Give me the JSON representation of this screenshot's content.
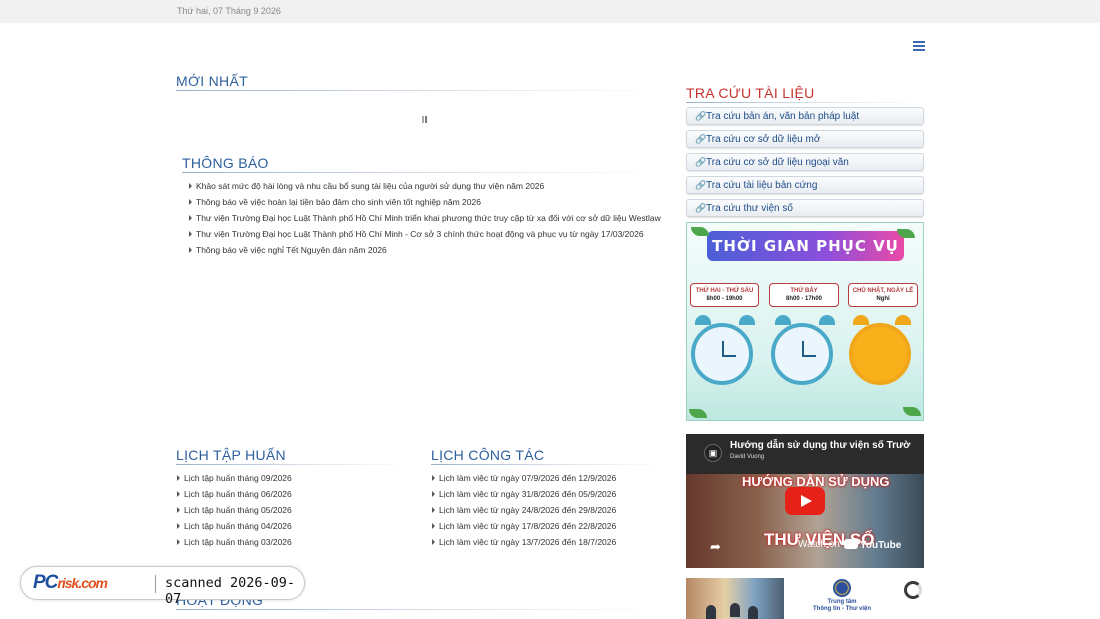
{
  "top_bar": {
    "date": "Thứ hai, 07 Tháng 9 2026"
  },
  "sections": {
    "moi_nhat": "MỚI NHẤT",
    "thong_bao": "THÔNG BÁO",
    "lich_tap_huan": "LỊCH TẬP HUẤN",
    "lich_cong_tac": "LỊCH CÔNG TÁC",
    "hoat_dong": "HOẠT ĐỘNG",
    "tra_cuu": "TRA CỨU TÀI LIỆU"
  },
  "thong_bao_items": [
    "Khảo sát mức độ hài lòng và nhu cầu bổ sung tài liệu của người sử dụng thư viện năm 2026",
    "Thông báo về việc hoàn lại tiền bảo đảm cho sinh viên tốt nghiệp năm 2026",
    "Thư viện Trường Đại học Luật Thành phố Hồ Chí Minh triển khai phương thức truy cập từ xa đối với cơ sở dữ liệu Westlaw",
    "Thư viện Trường Đại học Luật Thành phố Hồ Chí Minh - Cơ sở 3 chính thức hoạt động và phục vụ từ ngày 17/03/2026",
    "Thông báo về việc nghỉ Tết Nguyên đán năm 2026"
  ],
  "lich_tap_huan_items": [
    "Lịch tập huấn tháng 09/2026",
    "Lịch tập huấn tháng 06/2026",
    "Lịch tập huấn tháng 05/2026",
    "Lịch tập huấn tháng 04/2026",
    "Lịch tập huấn tháng 03/2026"
  ],
  "lich_cong_tac_items": [
    "Lịch làm việc từ ngày 07/9/2026 đến 12/9/2026",
    "Lịch làm việc từ ngày 31/8/2026 đến 05/9/2026",
    "Lịch làm việc từ ngày 24/8/2026 đến 29/8/2026",
    "Lịch làm việc từ ngày 17/8/2026 đến 22/8/2026",
    "Lịch làm việc từ ngày 13/7/2026 đến 18/7/2026"
  ],
  "tra_cuu_links": [
    "Tra cứu bản án, văn bản pháp luật",
    "Tra cứu cơ sở dữ liệu mở",
    "Tra cứu cơ sở dữ liệu ngoại văn",
    "Tra cứu tài liệu bản cứng",
    "Tra cứu thư viện số"
  ],
  "banner": {
    "title": "THỜI GIAN PHỤC VỤ",
    "slots": [
      {
        "days": "THỨ HAI - THỨ SÁU",
        "hours": "8h00 - 19h00"
      },
      {
        "days": "THỨ BẢY",
        "hours": "8h00 - 17h00"
      },
      {
        "days": "CHỦ NHẬT, NGÀY LỄ",
        "hours": "Nghỉ"
      }
    ]
  },
  "video": {
    "title": "Hướng dẫn sử dụng thư viện số Trườ",
    "channel": "David Vuong",
    "overlay_line1": "HƯỚNG DẪN SỬ DỤNG",
    "overlay_line2": "THƯ VIỆN SỐ",
    "watch_on": "Watch on",
    "youtube": "YouTube"
  },
  "center_logo": {
    "line1": "Trung tâm",
    "line2": "Thông tin - Thư viện"
  },
  "watermark": {
    "brand": "PC",
    "brand_suffix": "risk.com",
    "scanned": "scanned 2026-09-07"
  },
  "colors": {
    "heading_blue": "#2d5f9e",
    "heading_red": "#c7322f",
    "link_blue": "#1e4d8a"
  }
}
